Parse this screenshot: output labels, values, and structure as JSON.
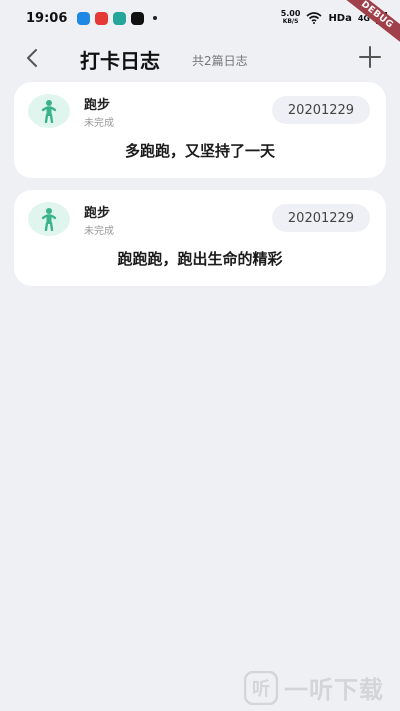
{
  "status_bar": {
    "time": "19:06",
    "net_speed_value": "5.00",
    "net_speed_unit": "KB/S",
    "hd_label": "HDa",
    "signal_label": "4G",
    "debug_label": "DEBUG",
    "app_icon_colors": [
      "#1e88e5",
      "#e53935",
      "#26a69a",
      "#111111"
    ]
  },
  "header": {
    "title": "打卡日志",
    "subtitle": "共2篇日志",
    "back_icon": "chevron-left-icon",
    "add_icon": "plus-icon"
  },
  "logs": [
    {
      "name": "跑步",
      "status": "未完成",
      "date": "20201229",
      "content": "多跑跑，又坚持了一天",
      "icon": "runner-icon"
    },
    {
      "name": "跑步",
      "status": "未完成",
      "date": "20201229",
      "content": "跑跑跑，跑出生命的精彩",
      "icon": "runner-icon"
    }
  ],
  "watermark": {
    "text": "一听下载"
  },
  "colors": {
    "background": "#eff0f4",
    "card": "#ffffff",
    "accent_green": "#3bb38a",
    "date_chip": "#eef0f5"
  }
}
